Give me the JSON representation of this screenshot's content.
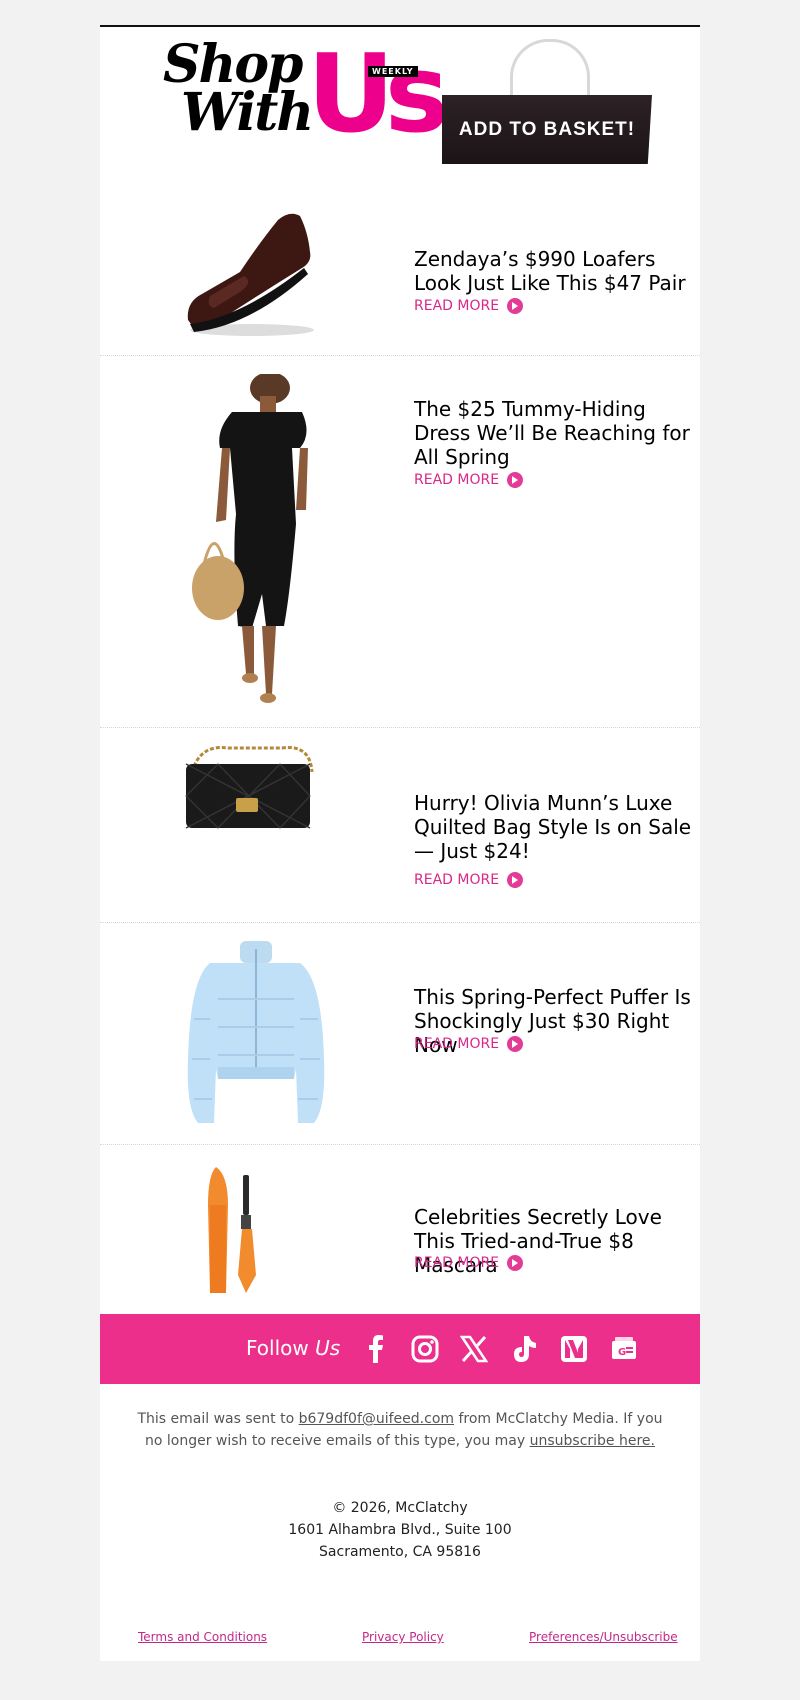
{
  "header": {
    "logo_shop": "Shop",
    "logo_with": "With",
    "logo_us": "Us",
    "logo_weekly": "WEEKLY",
    "bag_label": "ADD TO BASKET!"
  },
  "articles": [
    {
      "title": "Zendaya’s $990 Loafers Look Just Like This $47 Pair",
      "read_more": "READ MORE",
      "image": "brown-loafer-shoe"
    },
    {
      "title": "The $25 Tummy-Hiding Dress We’ll Be Reaching for All Spring",
      "read_more": "READ MORE",
      "image": "black-dress-model"
    },
    {
      "title": "Hurry! Olivia Munn’s Luxe Quilted Bag Style Is on Sale — Just $24!",
      "read_more": "READ MORE",
      "image": "black-quilted-bag"
    },
    {
      "title": "This Spring-Perfect Puffer Is Shockingly Just $30 Right Now",
      "read_more": "READ MORE",
      "image": "light-blue-puffer-jacket"
    },
    {
      "title": "Celebrities Secretly Love This Tried-and-True $8 Mascara",
      "read_more": "READ MORE",
      "image": "orange-mascara"
    }
  ],
  "follow": {
    "label": "Follow",
    "label_us": "Us",
    "icons": [
      "facebook-icon",
      "instagram-icon",
      "x-icon",
      "tiktok-icon",
      "apple-news-icon",
      "google-news-icon"
    ]
  },
  "footer": {
    "notice_prefix": "This email was sent to ",
    "email": "b679df0f@uifeed.com",
    "notice_mid": " from McClatchy Media. If you no longer wish to receive emails of this type, you may ",
    "unsubscribe": "unsubscribe here.",
    "copyright": "© 2026, McClatchy",
    "address1": "1601 Alhambra Blvd., Suite 100",
    "address2": "Sacramento, CA 95816",
    "links": {
      "terms": "Terms and Conditions",
      "privacy": "Privacy Policy",
      "preferences": "Preferences/Unsubscribe"
    }
  },
  "colors": {
    "accent": "#ec2f8b",
    "brand_pink": "#ec008c",
    "link": "#d9278a"
  }
}
